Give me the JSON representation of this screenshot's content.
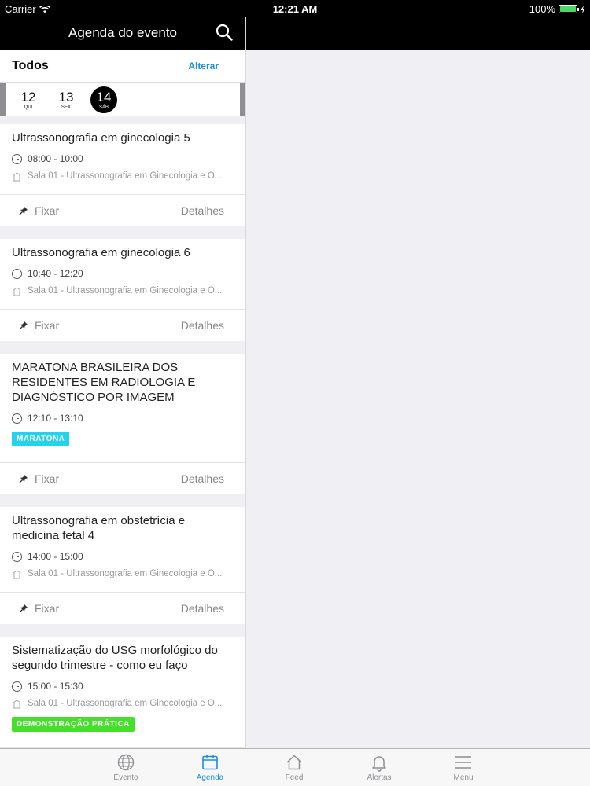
{
  "status_bar": {
    "carrier": "Carrier",
    "time": "12:21 AM",
    "battery": "100%",
    "battery_level": 1.0
  },
  "nav": {
    "title": "Agenda do evento"
  },
  "filter": {
    "label": "Todos",
    "action": "Alterar"
  },
  "dates": [
    {
      "day": "12",
      "weekday": "QUI",
      "active": false
    },
    {
      "day": "13",
      "weekday": "SEX",
      "active": false
    },
    {
      "day": "14",
      "weekday": "SÁB",
      "active": true
    }
  ],
  "sessions": [
    {
      "title": "Ultrassonografia em ginecologia 5",
      "time": "08:00 - 10:00",
      "room": "Sala 01 - Ultrassonografia em Ginecologia e O...",
      "tag": null,
      "pin_label": "Fixar",
      "details_label": "Detalhes"
    },
    {
      "title": "Ultrassonografia em ginecologia 6",
      "time": "10:40 - 12:20",
      "room": "Sala 01 - Ultrassonografia em Ginecologia e O...",
      "tag": null,
      "pin_label": "Fixar",
      "details_label": "Detalhes"
    },
    {
      "title": "MARATONA BRASILEIRA DOS RESIDENTES EM RADIOLOGIA E DIAGNÓSTICO POR IMAGEM",
      "time": "12:10 - 13:10",
      "room": null,
      "tag": {
        "label": "MARATONA",
        "color": "#22d3ee"
      },
      "pin_label": "Fixar",
      "details_label": "Detalhes"
    },
    {
      "title": "Ultrassonografia em obstetrícia e medicina fetal 4",
      "time": "14:00 - 15:00",
      "room": "Sala 01 - Ultrassonografia em Ginecologia e O...",
      "tag": null,
      "pin_label": "Fixar",
      "details_label": "Detalhes"
    },
    {
      "title": "Sistematização do USG morfológico do segundo trimestre - como eu faço",
      "time": "15:00 - 15:30",
      "room": "Sala 01 - Ultrassonografia em Ginecologia e O...",
      "tag": {
        "label": "DEMONSTRAÇÃO PRÁTICA",
        "color": "#45e12a"
      },
      "pin_label": "Fixar",
      "details_label": "Detalhes"
    }
  ],
  "tabs": [
    {
      "label": "Evento",
      "icon": "globe-icon",
      "active": false
    },
    {
      "label": "Agenda",
      "icon": "calendar-icon",
      "active": true
    },
    {
      "label": "Feed",
      "icon": "home-icon",
      "active": false
    },
    {
      "label": "Alertas",
      "icon": "bell-icon",
      "active": false
    },
    {
      "label": "Menu",
      "icon": "menu-icon",
      "active": false
    }
  ],
  "colors": {
    "accent": "#1a8ee1",
    "bar_bg": "#000000",
    "battery": "#4cd964"
  }
}
